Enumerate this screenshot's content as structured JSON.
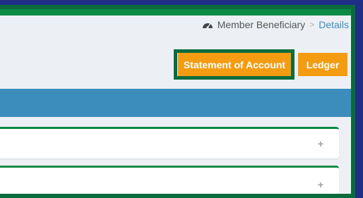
{
  "breadcrumb": {
    "icon": "dashboard-icon",
    "parent": "Member Beneficiary",
    "separator": ">",
    "current": "Details"
  },
  "actions": {
    "statement_label": "Statement of Account",
    "ledger_label": "Ledger"
  },
  "panels": [
    {
      "toggle": "+",
      "icon": "plus-icon"
    },
    {
      "toggle": "+",
      "icon": "plus-icon"
    }
  ],
  "colors": {
    "accent_green": "#0b8a45",
    "header_blue": "#3c8dbc",
    "button_orange": "#f39c12",
    "frame_navy": "#1f2f86"
  }
}
